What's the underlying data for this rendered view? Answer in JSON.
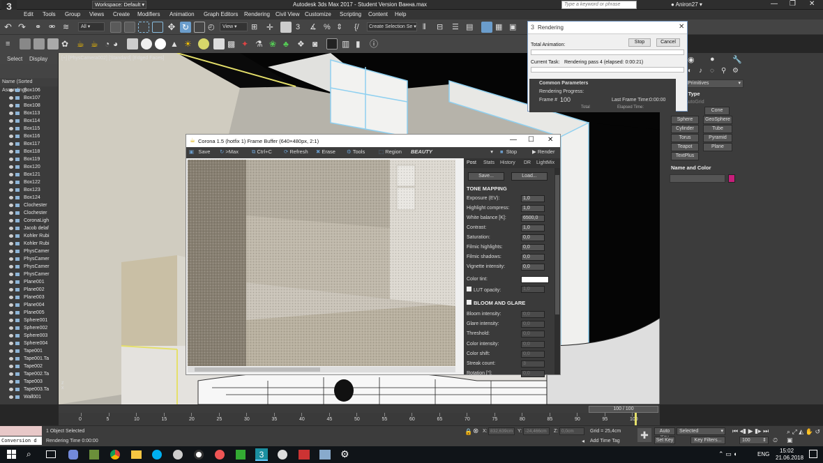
{
  "app": {
    "title": "Autodesk 3ds Max 2017 - Student Version   Ванна.max",
    "workspace": "Workspace: Default",
    "search_placeholder": "Type a keyword or phrase",
    "user": "Aniron27"
  },
  "menus": [
    "Edit",
    "Tools",
    "Group",
    "Views",
    "Create",
    "Modifiers",
    "Animation",
    "Graph Editors",
    "Rendering",
    "Civil View",
    "Customize",
    "Scripting",
    "Content",
    "Help"
  ],
  "toolbar": {
    "filter": "All",
    "view": "View",
    "create_selection": "Create Selection Se"
  },
  "scene_explorer": {
    "tabs": [
      "Select",
      "Display"
    ],
    "header": "Name (Sorted Ascending)",
    "items": [
      "Box106",
      "Box107",
      "Box108",
      "Box113",
      "Box114",
      "Box115",
      "Box116",
      "Box117",
      "Box118",
      "Box119",
      "Box120",
      "Box121",
      "Box122",
      "Box123",
      "Box124",
      "Clochester",
      "Clochester",
      "CoronaLigh",
      "Jacob delaf",
      "Kohler Rubi",
      "Kohler Rubi",
      "PhysCamer",
      "PhysCamer",
      "PhysCamer",
      "PhysCamer",
      "Plane001",
      "Plane002",
      "Plane003",
      "Plane004",
      "Plane005",
      "Sphere001",
      "Sphere002",
      "Sphere003",
      "Sphere004",
      "Tape001",
      "Tape001.Ta",
      "Tape002",
      "Tape002.Ta",
      "Tape003",
      "Tape003.Ta",
      "Wall001"
    ]
  },
  "viewport": {
    "label": "[+] [PhysCamera002] [Standard] [Edged Faces]",
    "frame_counter": "100 / 100"
  },
  "rendering_dialog": {
    "title": "Rendering",
    "stop": "Stop",
    "cancel": "Cancel",
    "total_animation": "Total Animation:",
    "current_task": "Current Task:",
    "task_value": "Rendering pass 4 (elapsed: 0:00:21)",
    "common_params": "Common Parameters",
    "rendering_progress": "Rendering Progress:",
    "frame_label": "Frame #",
    "frame_value": "100",
    "last_frame_time": "Last Frame Time:",
    "last_frame_value": "0:00:00",
    "elapsed_label": "Elapsed Time:",
    "total_label": "Total"
  },
  "command_panel": {
    "dropdown": "Primitives",
    "object_type": "t Type",
    "autogrid": "AutoGrid",
    "buttons": [
      "Cone",
      "Sphere",
      "GeoSphere",
      "Cylinder",
      "Tube",
      "Torus",
      "Pyramid",
      "Teapot",
      "Plane",
      "TextPlus"
    ],
    "name_color": "Name and Color",
    "swatch_color": "#c71e7a"
  },
  "frame_buffer": {
    "title": "Corona 1.5 (hotfix 1) Frame Buffer (640×480px, 2:1)",
    "toolbar": [
      "Save",
      ">Max",
      "Ctrl+C",
      "Refresh",
      "Erase",
      "Tools",
      "Region"
    ],
    "channel": "BEAUTY",
    "stop": "Stop",
    "render": "Render",
    "tabs": [
      "Post",
      "Stats",
      "History",
      "DR",
      "LightMix"
    ],
    "save_btn": "Save...",
    "load_btn": "Load...",
    "tone_mapping": "TONE MAPPING",
    "params": [
      {
        "label": "Exposure (EV):",
        "value": "1,0"
      },
      {
        "label": "Highlight compress:",
        "value": "1,0"
      },
      {
        "label": "White balance [K]:",
        "value": "6500,0"
      },
      {
        "label": "Contrast:",
        "value": "1,0"
      },
      {
        "label": "Saturation:",
        "value": "0,0"
      },
      {
        "label": "Filmic highlights:",
        "value": "0,0"
      },
      {
        "label": "Filmic shadows:",
        "value": "0,0"
      },
      {
        "label": "Vignette intensity:",
        "value": "0,0"
      }
    ],
    "color_tint": "Color tint:",
    "lut_opacity": "LUT opacity:",
    "lut_value": "1,0",
    "bloom_glare": "BLOOM AND GLARE",
    "bloom_params": [
      {
        "label": "Bloom intensity:",
        "value": "0,0"
      },
      {
        "label": "Glare intensity:",
        "value": "0,0"
      },
      {
        "label": "Threshold:",
        "value": "0,0"
      },
      {
        "label": "Color intensity:",
        "value": "0,0"
      },
      {
        "label": "Color shift:",
        "value": "0,0"
      },
      {
        "label": "Streak count:",
        "value": "3"
      },
      {
        "label": "Rotation [°]:",
        "value": "0,0"
      }
    ]
  },
  "timeline": {
    "ticks": [
      "0",
      "5",
      "10",
      "15",
      "20",
      "25",
      "30",
      "35",
      "40",
      "45",
      "50",
      "55",
      "60",
      "65",
      "70",
      "75",
      "80",
      "85",
      "90",
      "95",
      "100"
    ]
  },
  "status": {
    "selected": "1 Object Selected",
    "rendering_time": "Rendering Time 0:00:00",
    "conversion": "Conversion d",
    "x_label": "X:",
    "x_value": "832,639cm",
    "y_label": "Y:",
    "y_value": "-24,466cm",
    "z_label": "Z:",
    "z_value": "0,0cm",
    "grid": "Grid = 25,4cm",
    "add_time_tag": "Add Time Tag",
    "auto_key": "Auto Key",
    "set_key": "Set Key",
    "selected_dd": "Selected",
    "key_filters": "Key Filters...",
    "frame_field": "100"
  },
  "taskbar": {
    "lang": "ENG",
    "time": "15:02",
    "date": "21.06.2018"
  }
}
